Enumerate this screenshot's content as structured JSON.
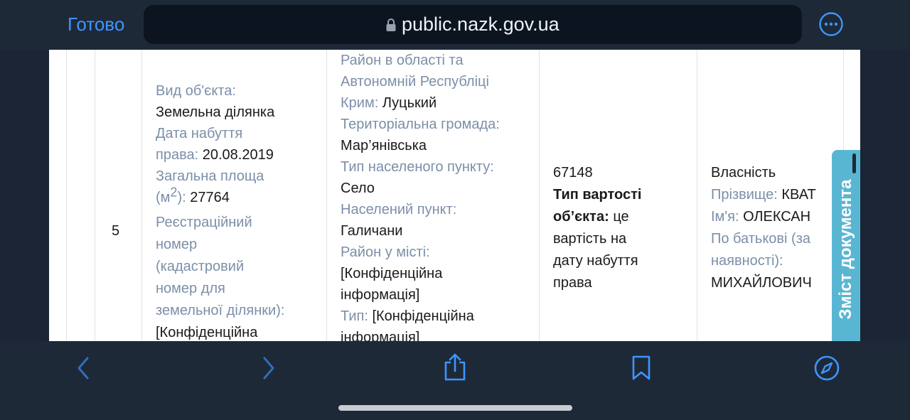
{
  "browser": {
    "done_label": "Готово",
    "url": "public.nazk.gov.ua"
  },
  "row": {
    "number": "5",
    "object": {
      "type_label": "Вид об'єкта:",
      "type_value": "Земельна ділянка",
      "date_label_1": "Дата набуття",
      "date_label_2": "права:",
      "date_value": "20.08.2019",
      "area_label_1": "Загальна площа",
      "area_label_2a": "(м",
      "area_label_sup": "2",
      "area_label_2b": "):",
      "area_value": "27764",
      "reg_label_1": "Реєстраційний",
      "reg_label_2": "номер",
      "reg_label_3": "(кадастровий",
      "reg_label_4": "номер для",
      "reg_label_5": "земельної ділянки):",
      "reg_value_partial": "[Конфіденційна"
    },
    "location": {
      "district_label_1": "Район в області та",
      "district_label_2": "Автономній Республіці",
      "district_label_3": "Крим:",
      "district_value": "Луцький",
      "community_label": "Територіальна громада:",
      "community_value": "Мар’янівська",
      "settlement_type_label": "Тип населеного пункту:",
      "settlement_type_value": "Село",
      "settlement_label": "Населений пункт:",
      "settlement_value": "Галичани",
      "city_district_label": "Район у місті:",
      "city_district_value_1": "[Конфіденційна",
      "city_district_value_2": "інформація]",
      "type_label": "Тип:",
      "type_value_1": "[Конфіденційна",
      "type_value_2": "інформація]"
    },
    "cost": {
      "value": "67148",
      "type_label_1": "Тип вартості",
      "type_label_2": "об’єкта:",
      "type_value_1": "це",
      "type_value_2": "вартість на",
      "type_value_3": "дату набуття",
      "type_value_4": "права"
    },
    "owner": {
      "right_value": "Власність",
      "surname_label": "Прізвище:",
      "surname_value": "КВАТ",
      "name_label": "Ім'я:",
      "name_value": "ОЛЕКСАН",
      "patronymic_label_1": "По батькові (за",
      "patronymic_label_2": "наявності):",
      "patronymic_value": "МИХАЙЛОВИЧ"
    }
  },
  "side_tab": {
    "label": "Зміст документа"
  },
  "toolbar": {
    "icons": [
      "back-icon",
      "forward-icon",
      "share-icon",
      "bookmarks-icon",
      "compass-icon"
    ]
  },
  "colors": {
    "accent": "#3e95ff",
    "label": "#7b8fa8",
    "tab": "#59b6d2"
  }
}
